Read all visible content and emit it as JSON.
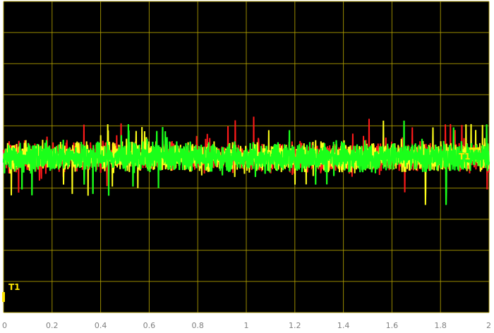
{
  "chart_data": {
    "type": "line",
    "title": "",
    "xlabel": "",
    "ylabel": "",
    "xlim": [
      0,
      2
    ],
    "x_ticks": [
      "0",
      "0.2",
      "0.4",
      "0.6",
      "0.8",
      "1",
      "1.2",
      "1.4",
      "1.6",
      "1.8",
      "2"
    ],
    "grid": true,
    "y_divisions": 10,
    "background": "#000000",
    "grid_color": "#b3a100",
    "series": [
      {
        "color": "#ff1a1a",
        "center_fraction": 0.5,
        "spread_fraction": 0.08,
        "approx_samples": 2000
      },
      {
        "color": "#ffff1a",
        "center_fraction": 0.5,
        "spread_fraction": 0.08,
        "approx_samples": 2000
      },
      {
        "color": "#1aff1a",
        "center_fraction": 0.5,
        "spread_fraction": 0.08,
        "approx_samples": 2000
      }
    ],
    "markers": [
      {
        "label": "T1",
        "color": "#ffe600",
        "position": "left-bottom",
        "level_fraction": 0.05
      },
      {
        "label": "T1",
        "color": "#ffe600",
        "position": "right-middle",
        "level_fraction": 0.51
      }
    ]
  }
}
